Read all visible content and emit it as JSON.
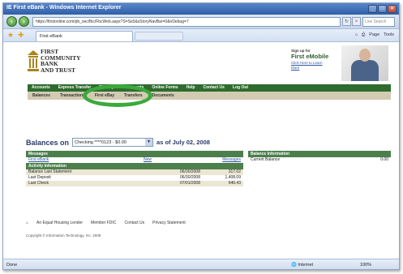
{
  "browser": {
    "title": "IE First eBank - Windows Internet Explorer",
    "address": "https://firstonline.com/pb_sec/fbc/FbcWeb.aspx?S=Ss5&sStoryNavBar=0&nDebug=7",
    "search_placeholder": "Live Search",
    "tab_title": "First eBank",
    "tools": [
      "Page",
      "Tools"
    ],
    "status": "Done",
    "zone": "Internet",
    "zoom": "100%"
  },
  "bank": {
    "name_lines": [
      "FIRST",
      "COMMUNITY",
      "BANK",
      "AND TRUST"
    ]
  },
  "promo": {
    "small": "Sign up for",
    "title": "First eMobile",
    "link": "Click Here to Learn More"
  },
  "top_nav": [
    "Accounts",
    "Express Transfer",
    "Bill Pay",
    "Statements",
    "Online Forms",
    "Help",
    "Contact Us",
    "Log Out"
  ],
  "sub_nav": [
    "Balances",
    "Transactions",
    "First eBay",
    "Transfers",
    "Documents"
  ],
  "balances": {
    "heading": "Balances on",
    "account": "Checking ****0123 - $0.00",
    "date": "as of July 02, 2008"
  },
  "messages": {
    "header": "Messages",
    "row": {
      "from": "First eBank",
      "subject": "New",
      "link": "Messages"
    }
  },
  "activity": {
    "header": "Activity Information",
    "rows": [
      {
        "label": "Balance Last Statement",
        "date": "06/30/2008",
        "amount": "317.02"
      },
      {
        "label": "Last Deposit",
        "date": "06/30/2008",
        "amount": "1,408.09"
      },
      {
        "label": "Last Check",
        "date": "07/01/2008",
        "amount": "646.43"
      }
    ]
  },
  "balance_info": {
    "header": "Balance Information",
    "rows": [
      {
        "label": "Current Balance",
        "amount": "0.00"
      }
    ]
  },
  "footer": {
    "links": [
      "An Equal Housing Lender",
      "Member FDIC",
      "Contact Us",
      "Privacy Statement"
    ],
    "copyright": "Copyright © Information Technology, Inc. 2008"
  },
  "colors": {
    "accent_green": "#2e6b2e",
    "highlight_ring": "#3aaa3a",
    "subnav_tan": "#d2cbb2"
  }
}
